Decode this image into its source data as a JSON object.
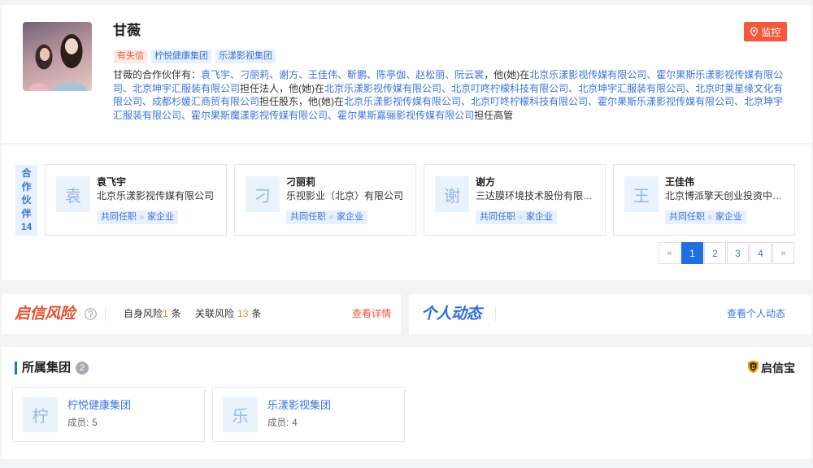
{
  "profile": {
    "name": "甘薇",
    "monitor_label": "监控",
    "tags": [
      {
        "label": "有失信"
      },
      {
        "label": "柠悦健康集团"
      },
      {
        "label": "乐漾影视集团"
      }
    ],
    "description": [
      {
        "text": "甘薇的合作伙伴有：",
        "link": false
      },
      {
        "text": "袁飞宇",
        "link": true
      },
      {
        "text": "、",
        "link": false,
        "blue": true
      },
      {
        "text": "刁丽莉",
        "link": true
      },
      {
        "text": "、",
        "link": false,
        "blue": true
      },
      {
        "text": "谢方",
        "link": true
      },
      {
        "text": "、",
        "link": false,
        "blue": true
      },
      {
        "text": "王佳伟",
        "link": true
      },
      {
        "text": "、",
        "link": false,
        "blue": true
      },
      {
        "text": "靳鹏",
        "link": true
      },
      {
        "text": "、",
        "link": false,
        "blue": true
      },
      {
        "text": "陈亭伽",
        "link": true
      },
      {
        "text": "、",
        "link": false,
        "blue": true
      },
      {
        "text": "赵松丽",
        "link": true
      },
      {
        "text": "、",
        "link": false,
        "blue": true
      },
      {
        "text": "阮云裳",
        "link": true
      },
      {
        "text": "，他(她)在",
        "link": false
      },
      {
        "text": "北京乐漾影视传媒有限公司",
        "link": true
      },
      {
        "text": "、",
        "link": false,
        "blue": true
      },
      {
        "text": "霍尔果斯乐漾影视传媒有限公司",
        "link": true
      },
      {
        "text": "、",
        "link": false,
        "blue": true
      },
      {
        "text": "北京坤宇汇服装有限公司",
        "link": true
      },
      {
        "text": "担任法人，他(她)在",
        "link": false
      },
      {
        "text": "北京乐漾影视传媒有限公司",
        "link": true
      },
      {
        "text": "、",
        "link": false,
        "blue": true
      },
      {
        "text": "北京叮咚柠檬科技有限公司",
        "link": true
      },
      {
        "text": "、",
        "link": false,
        "blue": true
      },
      {
        "text": "北京坤宇汇服装有限公司",
        "link": true
      },
      {
        "text": "、",
        "link": false,
        "blue": true
      },
      {
        "text": "北京时莱星缘文化有限公司",
        "link": true
      },
      {
        "text": "、",
        "link": false,
        "blue": true
      },
      {
        "text": "成都杉媛汇商贸有限公司",
        "link": true
      },
      {
        "text": "担任股东，他(她)在",
        "link": false
      },
      {
        "text": "北京乐漾影视传媒有限公司",
        "link": true
      },
      {
        "text": "、",
        "link": false,
        "blue": true
      },
      {
        "text": "北京叮咚柠檬科技有限公司",
        "link": true
      },
      {
        "text": "、",
        "link": false,
        "blue": true
      },
      {
        "text": "霍尔果斯乐漾影视传媒有限公司",
        "link": true
      },
      {
        "text": "、",
        "link": false,
        "blue": true
      },
      {
        "text": "北京坤宇汇服装有限公司",
        "link": true
      },
      {
        "text": "、",
        "link": false,
        "blue": true
      },
      {
        "text": "霍尔果斯魔漾影视传媒有限公司",
        "link": true
      },
      {
        "text": "、",
        "link": false,
        "blue": true
      },
      {
        "text": "霍尔果斯嘉骊影视传媒有限公司",
        "link": true
      },
      {
        "text": "担任高管",
        "link": false
      }
    ]
  },
  "partners": {
    "label": "合作伙伴",
    "count": "14",
    "items": [
      {
        "initial": "袁",
        "name": "袁飞宇",
        "company": "北京乐漾影视传媒有限公司",
        "tag_joint": "共同任职",
        "tag_firms": "家企业"
      },
      {
        "initial": "刁",
        "name": "刁丽莉",
        "company": "乐视影业（北京）有限公司",
        "tag_joint": "共同任职",
        "tag_firms": "家企业"
      },
      {
        "initial": "谢",
        "name": "谢方",
        "company": "三达膜环境技术股份有限公司",
        "tag_joint": "共同任职",
        "tag_firms": "家企业"
      },
      {
        "initial": "王",
        "name": "王佳伟",
        "company": "北京博派擎天创业投资中心...",
        "tag_joint": "共同任职",
        "tag_firms": "家企业"
      }
    ],
    "pagination": {
      "prev": "«",
      "next": "»",
      "pages": [
        "1",
        "2",
        "3",
        "4"
      ],
      "current": 1
    }
  },
  "risk": {
    "title": "启信风险",
    "self_label": "自身风险",
    "self_count": "1",
    "self_unit": "条",
    "related_label": "关联风险",
    "related_count": "13",
    "related_unit": "条",
    "detail_link": "查看详情"
  },
  "dynamics": {
    "title": "个人动态",
    "link": "查看个人动态"
  },
  "groups": {
    "title": "所属集团",
    "count": "2",
    "brand": "启信宝",
    "items": [
      {
        "initial": "柠",
        "name": "柠悦健康集团",
        "members_label": "成员:",
        "members": "5"
      },
      {
        "initial": "乐",
        "name": "乐漾影视集团",
        "members_label": "成员:",
        "members": "4"
      }
    ]
  },
  "icons": [
    "location-pin-icon",
    "help-icon",
    "shield-logo-icon"
  ],
  "colors": {
    "link": "#3b74d8",
    "monitor_button": "#f1593a",
    "risk_title": "#e4502d",
    "risk_count": "#f08a24",
    "detail_link": "#f0573b",
    "dynamics_title": "#2f6bd9",
    "page_active": "#1f6fe3",
    "brand_shield": "#e8a317"
  }
}
